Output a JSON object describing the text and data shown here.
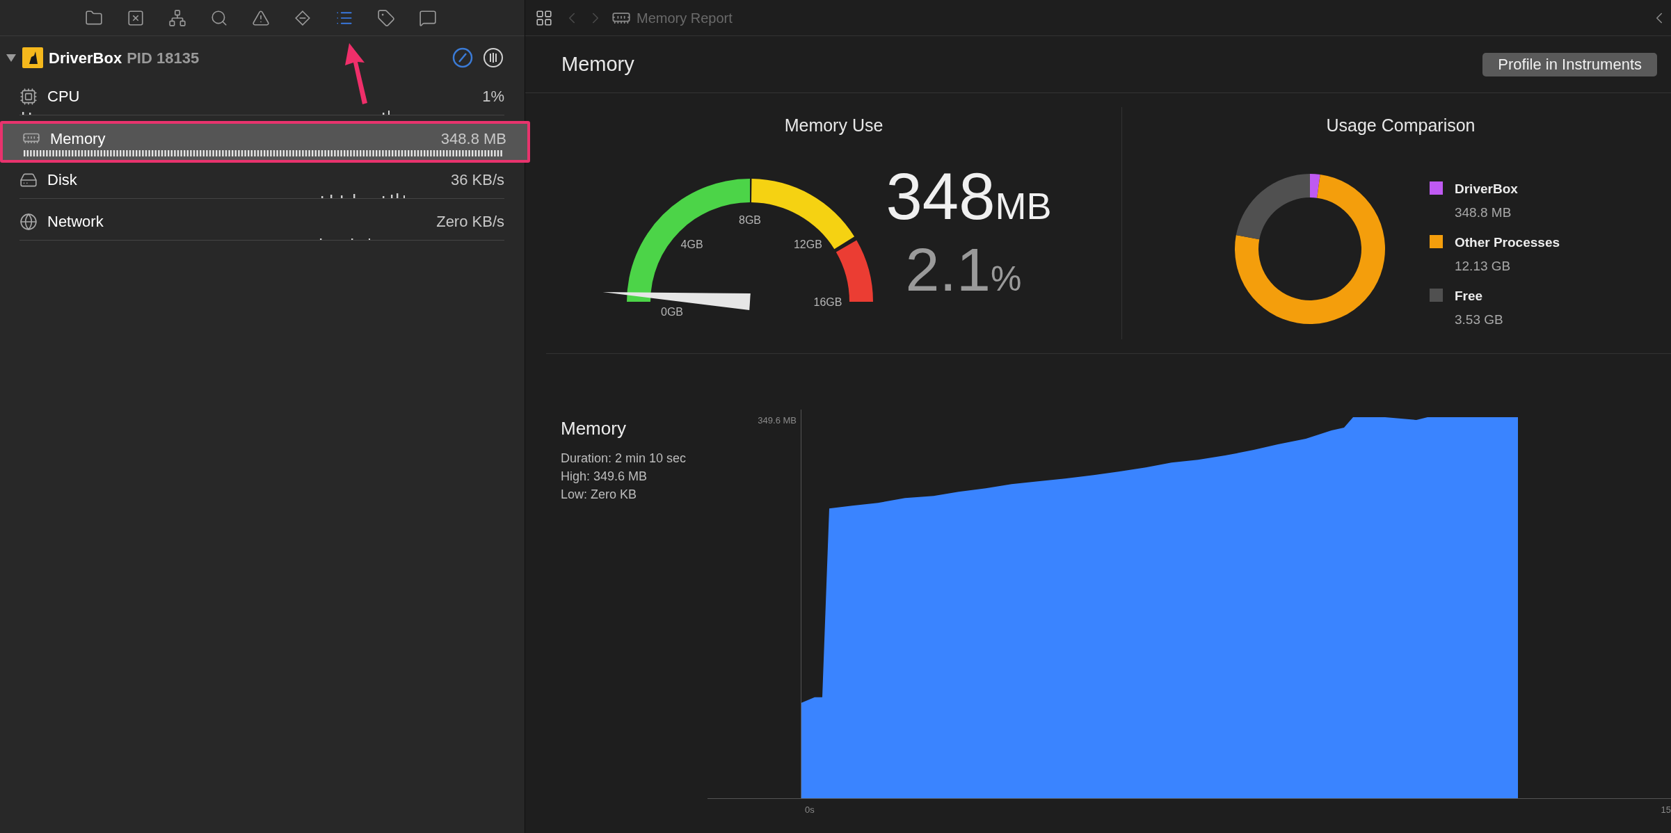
{
  "navigator_tabs": [
    {
      "selected": false
    },
    {
      "selected": false
    },
    {
      "selected": false
    },
    {
      "selected": false
    },
    {
      "selected": false
    },
    {
      "selected": false
    },
    {
      "selected": true
    },
    {
      "selected": false
    },
    {
      "selected": false
    }
  ],
  "process": {
    "name": "DriverBox",
    "pid": "PID 18135",
    "expanded": true
  },
  "gauges": [
    {
      "kind": "cpu",
      "name": "CPU",
      "value": "1%",
      "selected": false,
      "highlighted": false
    },
    {
      "kind": "memory",
      "name": "Memory",
      "value": "348.8 MB",
      "selected": true,
      "highlighted": true
    },
    {
      "kind": "disk",
      "name": "Disk",
      "value": "36 KB/s",
      "selected": false,
      "highlighted": false
    },
    {
      "kind": "network",
      "name": "Network",
      "value": "Zero KB/s",
      "selected": false,
      "highlighted": false
    }
  ],
  "editor": {
    "breadcrumb": "Memory Report",
    "back_enabled": false,
    "forward_enabled": false
  },
  "header": {
    "title": "Memory",
    "button": "Profile in Instruments"
  },
  "memory_use": {
    "title": "Memory Use",
    "gauge": {
      "ticks": [
        "0GB",
        "4GB",
        "8GB",
        "12GB",
        "16GB"
      ],
      "level": 0.021
    },
    "amount": "348",
    "amount_unit": "MB",
    "percent": "2.1",
    "percent_unit": "%"
  },
  "usage_comparison": {
    "title": "Usage Comparison",
    "legend": [
      {
        "label": "DriverBox",
        "value": "348.8 MB",
        "color": "#bf5af2"
      },
      {
        "label": "Other Processes",
        "value": "12.13 GB",
        "color": "#f49e0c"
      },
      {
        "label": "Free",
        "value": "3.53 GB",
        "color": "#505050"
      }
    ],
    "chart_data": {
      "type": "donut",
      "values": [
        2.18,
        75.77,
        22.05
      ]
    }
  },
  "memory_graph": {
    "title": "Memory",
    "stats": [
      "Duration: 2 min 10 sec",
      "High: 349.6 MB",
      "Low: Zero KB"
    ],
    "y_max": "349.6 MB",
    "x_ticks": [
      "0s",
      "15"
    ]
  }
}
